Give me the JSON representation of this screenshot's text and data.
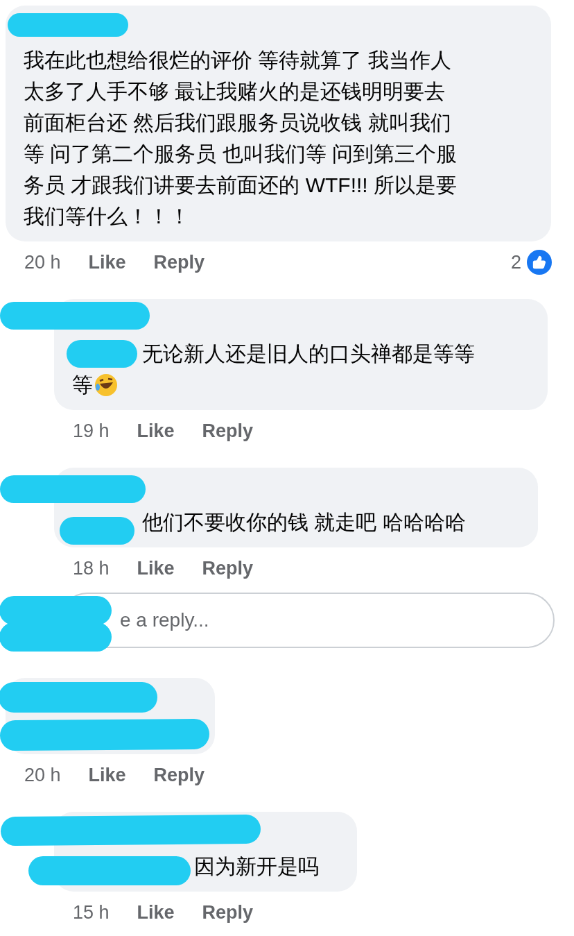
{
  "comments": [
    {
      "lines": [
        "我在此也想给很烂的评价 等待就算了 我当作人",
        "太多了人手不够 最让我赌火的是还钱明明要去",
        "前面柜台还 然后我们跟服务员说收钱 就叫我们",
        "等 问了第二个服务员 也叫我们等 问到第三个服",
        "务员 才跟我们讲要去前面还的 WTF!!! 所以是要",
        "我们等什么！！！"
      ],
      "kind": "plain",
      "time": "20 h",
      "actions": [
        "Like",
        "Reply"
      ],
      "reactions": "2",
      "replies": [
        {
          "lines": [
            "无论新人还是旧人的口头禅都是等等",
            "等"
          ],
          "kind": "short_tag",
          "emoji": true,
          "time": "19 h",
          "actions": [
            "Like",
            "Reply"
          ]
        },
        {
          "lines": [
            "他们不要收你的钱 就走吧 哈哈哈哈"
          ],
          "kind": "short_tag",
          "time": "18 h",
          "actions": [
            "Like",
            "Reply"
          ]
        }
      ],
      "reply_field": {
        "placeholder": "e a reply..."
      }
    },
    {
      "kind": "hidden",
      "time": "20 h",
      "actions": [
        "Like",
        "Reply"
      ],
      "replies": [
        {
          "lines": [
            "因为新开是吗"
          ],
          "kind": "long_tag",
          "time": "15 h",
          "actions": [
            "Like",
            "Reply"
          ]
        }
      ]
    }
  ]
}
